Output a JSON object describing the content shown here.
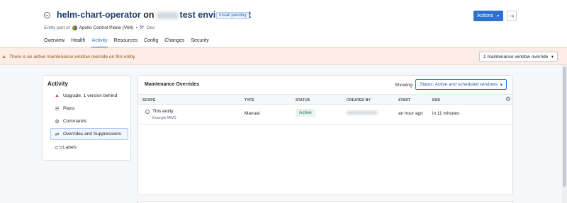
{
  "header": {
    "app_name": "helm-chart-operator",
    "on_word": "on",
    "environment": "test environment",
    "badge": "Install pending",
    "entity_part_of": "Entity part of",
    "control_plane": "Apollo Control Plane (V64)",
    "separator": "•",
    "env_tag": "Dev",
    "actions_label": "Actions",
    "tabs": [
      "Overview",
      "Health",
      "Activity",
      "Resources",
      "Config",
      "Changes",
      "Security"
    ]
  },
  "banner": {
    "text": "There is an active maintenance window override on this entity",
    "select_label": "1 maintenance window override"
  },
  "sidebar": {
    "title": "Activity",
    "items": [
      {
        "label": "Upgrade: 1 version behind",
        "icon": "warning-icon"
      },
      {
        "label": "Plans",
        "icon": "list-icon"
      },
      {
        "label": "Commands",
        "icon": "commands-icon"
      },
      {
        "label": "Overrides and Suppressions",
        "icon": "overrides-icon"
      },
      {
        "label": "Labels",
        "icon": "label-icon"
      }
    ]
  },
  "main": {
    "title": "Maintenance Overrides",
    "showing_label": "Showing",
    "status_filter": "Status: Active and scheduled windows",
    "columns": [
      "SCOPE",
      "TYPE",
      "STATUS",
      "CREATED BY",
      "START",
      "END"
    ],
    "rows": [
      {
        "scope": "This entity",
        "scope_sub": "Example MWO",
        "type": "Manual",
        "status": "Active",
        "start": "an hour ago",
        "end": "in 11 minutes"
      }
    ]
  },
  "colors": {
    "accent": "#2d72d2",
    "active_tag": "#e8f3ea",
    "banner_bg": "#fbede5"
  }
}
